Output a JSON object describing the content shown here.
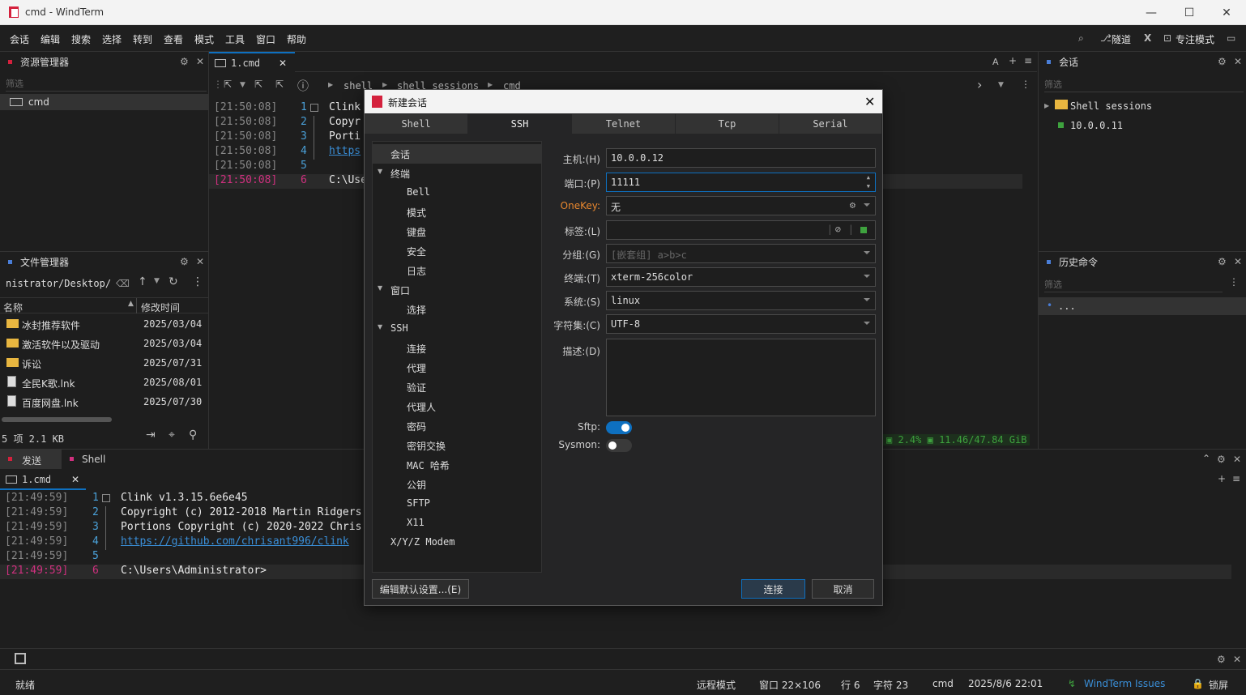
{
  "window": {
    "title": "cmd - WindTerm"
  },
  "menu": [
    "会话",
    "编辑",
    "搜索",
    "选择",
    "转到",
    "查看",
    "模式",
    "工具",
    "窗口",
    "帮助"
  ],
  "menu_right": {
    "tunnel": "隧道",
    "focus": "专注模式"
  },
  "explorer": {
    "title": "资源管理器",
    "filter_placeholder": "筛选",
    "items": [
      "cmd"
    ]
  },
  "file_manager": {
    "title": "文件管理器",
    "path": "nistrator/Desktop/",
    "col_name": "名称",
    "col_time": "修改时间",
    "files": [
      {
        "name": "冰封推荐软件",
        "time": "2025/03/04",
        "type": "folder"
      },
      {
        "name": "激活软件以及驱动",
        "time": "2025/03/04",
        "type": "folder"
      },
      {
        "name": "诉讼",
        "time": "2025/07/31",
        "type": "folder"
      },
      {
        "name": "全民K歌.lnk",
        "time": "2025/08/01",
        "type": "file"
      },
      {
        "name": "百度网盘.lnk",
        "time": "2025/07/30",
        "type": "file"
      }
    ],
    "summary": "5 项 2.1 KB"
  },
  "main_tab": {
    "label": "1.cmd",
    "breadcrumb": [
      "shell",
      "shell sessions",
      "cmd"
    ],
    "lines": [
      {
        "time": "[21:50:08]",
        "num": "1",
        "text": "Clink"
      },
      {
        "time": "[21:50:08]",
        "num": "2",
        "text": "Copyr"
      },
      {
        "time": "[21:50:08]",
        "num": "3",
        "text": "Porti"
      },
      {
        "time": "[21:50:08]",
        "num": "4",
        "text": "https"
      },
      {
        "time": "[21:50:08]",
        "num": "5",
        "text": ""
      },
      {
        "time": "[21:50:08]",
        "num": "6",
        "text": "C:\\Use"
      }
    ],
    "status_cpu": "2.4%",
    "status_mem": "11.46/47.84 GiB"
  },
  "sessions_panel": {
    "title": "会话",
    "filter_placeholder": "筛选",
    "folder": "Shell sessions",
    "host": "10.0.0.11"
  },
  "history_panel": {
    "title": "历史命令",
    "filter_placeholder": "筛选",
    "item": "..."
  },
  "bottom": {
    "tabs": [
      "发送",
      "Shell"
    ],
    "sub_tab": "1.cmd",
    "lines": [
      {
        "time": "[21:49:59]",
        "num": "1",
        "text": "Clink v1.3.15.6e6e45"
      },
      {
        "time": "[21:49:59]",
        "num": "2",
        "text": "Copyright (c) 2012-2018 Martin Ridgers"
      },
      {
        "time": "[21:49:59]",
        "num": "3",
        "text": "Portions Copyright (c) 2020-2022 Chris"
      },
      {
        "time": "[21:49:59]",
        "num": "4",
        "text": "https://github.com/chrisant996/clink"
      },
      {
        "time": "[21:49:59]",
        "num": "5",
        "text": ""
      },
      {
        "time": "[21:49:59]",
        "num": "6",
        "text": "C:\\Users\\Administrator>"
      }
    ]
  },
  "dialog": {
    "title": "新建会话",
    "tabs": [
      "Shell",
      "SSH",
      "Telnet",
      "Tcp",
      "Serial"
    ],
    "active_tab": "SSH",
    "tree": [
      {
        "label": "会话",
        "level": 0
      },
      {
        "label": "终端",
        "level": 0,
        "expand": true
      },
      {
        "label": "Bell",
        "level": 1
      },
      {
        "label": "模式",
        "level": 1
      },
      {
        "label": "键盘",
        "level": 1
      },
      {
        "label": "安全",
        "level": 1
      },
      {
        "label": "日志",
        "level": 1
      },
      {
        "label": "窗口",
        "level": 0,
        "expand": true
      },
      {
        "label": "选择",
        "level": 1
      },
      {
        "label": "SSH",
        "level": 0,
        "expand": true
      },
      {
        "label": "连接",
        "level": 1
      },
      {
        "label": "代理",
        "level": 1
      },
      {
        "label": "验证",
        "level": 1
      },
      {
        "label": "代理人",
        "level": 1
      },
      {
        "label": "密码",
        "level": 1
      },
      {
        "label": "密钥交换",
        "level": 1
      },
      {
        "label": "MAC 哈希",
        "level": 1
      },
      {
        "label": "公钥",
        "level": 1
      },
      {
        "label": "SFTP",
        "level": 1
      },
      {
        "label": "X11",
        "level": 1
      },
      {
        "label": "X/Y/Z Modem",
        "level": 0
      }
    ],
    "fields": {
      "host_label": "主机:(H)",
      "host": "10.0.0.12",
      "port_label": "端口:(P)",
      "port": "11111",
      "onekey_label": "OneKey:",
      "onekey": "无",
      "tag_label": "标签:(L)",
      "tag": "",
      "group_label": "分组:(G)",
      "group_placeholder": "[嵌套组] a>b>c",
      "term_label": "终端:(T)",
      "term": "xterm-256color",
      "system_label": "系统:(S)",
      "system": "linux",
      "charset_label": "字符集:(C)",
      "charset": "UTF-8",
      "desc_label": "描述:(D)",
      "sftp_label": "Sftp:",
      "sftp_on": true,
      "sysmon_label": "Sysmon:",
      "sysmon_on": false
    },
    "edit_default": "编辑默认设置...(E)",
    "connect": "连接",
    "cancel": "取消"
  },
  "statusbar": {
    "ready": "就绪",
    "remote_mode": "远程模式",
    "window_size": "窗口 22×106",
    "row": "行 6",
    "col": "字符 23",
    "shell": "cmd",
    "datetime": "2025/8/6 22:01",
    "issues": "WindTerm Issues",
    "lock": "锁屏"
  },
  "colors": {
    "accent": "#0e70c0",
    "red": "#d4213d",
    "magenta": "#d0307f",
    "green": "#3ea23e"
  }
}
